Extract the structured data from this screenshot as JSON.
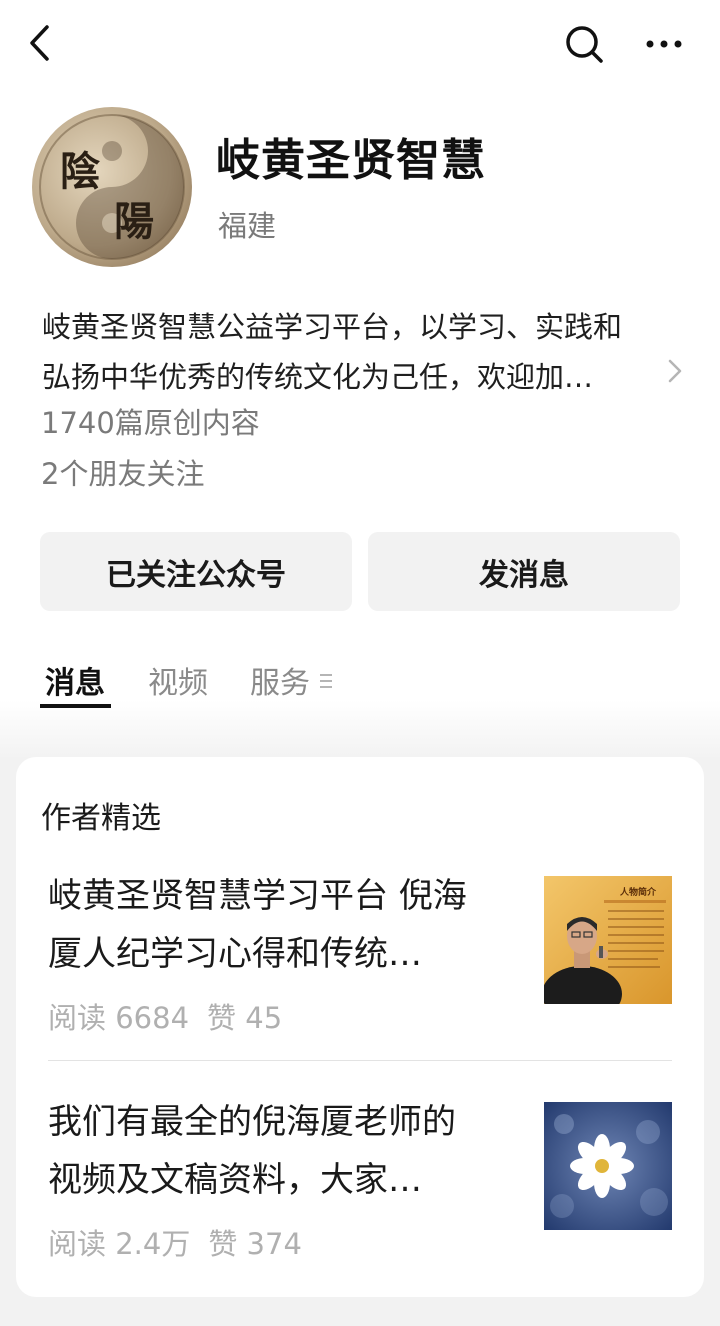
{
  "account": {
    "name": "岐黄圣贤智慧",
    "region": "福建",
    "description_lines": [
      "岐黄圣贤智慧公益学习平台，以学习、实践和",
      "弘扬中华优秀的传统文化为己任，欢迎加…"
    ],
    "original_count": "1740篇原创内容",
    "friends_following": "2个朋友关注",
    "avatar_text": [
      "陰",
      "陽"
    ]
  },
  "actions": {
    "follow_label": "已关注公众号",
    "message_label": "发消息"
  },
  "tabs": [
    {
      "label": "消息",
      "active": true
    },
    {
      "label": "视频",
      "active": false
    },
    {
      "label": "服务",
      "active": false
    }
  ],
  "featured": {
    "title": "作者精选",
    "articles": [
      {
        "title_lines": [
          "岐黄圣贤智慧学习平台 倪海",
          "厦人纪学习心得和传统…"
        ],
        "reads": "阅读 6684",
        "likes": "赞 45",
        "thumb_caption": "人物简介"
      },
      {
        "title_lines": [
          "我们有最全的倪海厦老师的",
          "视频及文稿资料，大家…"
        ],
        "reads": "阅读 2.4万",
        "likes": "赞 374"
      }
    ]
  },
  "icons": {
    "back": "chevron-left-icon",
    "search": "search-icon",
    "more": "more-dots-icon",
    "expand": "chevron-right-icon",
    "tab_menu": "menu-lines-icon"
  }
}
